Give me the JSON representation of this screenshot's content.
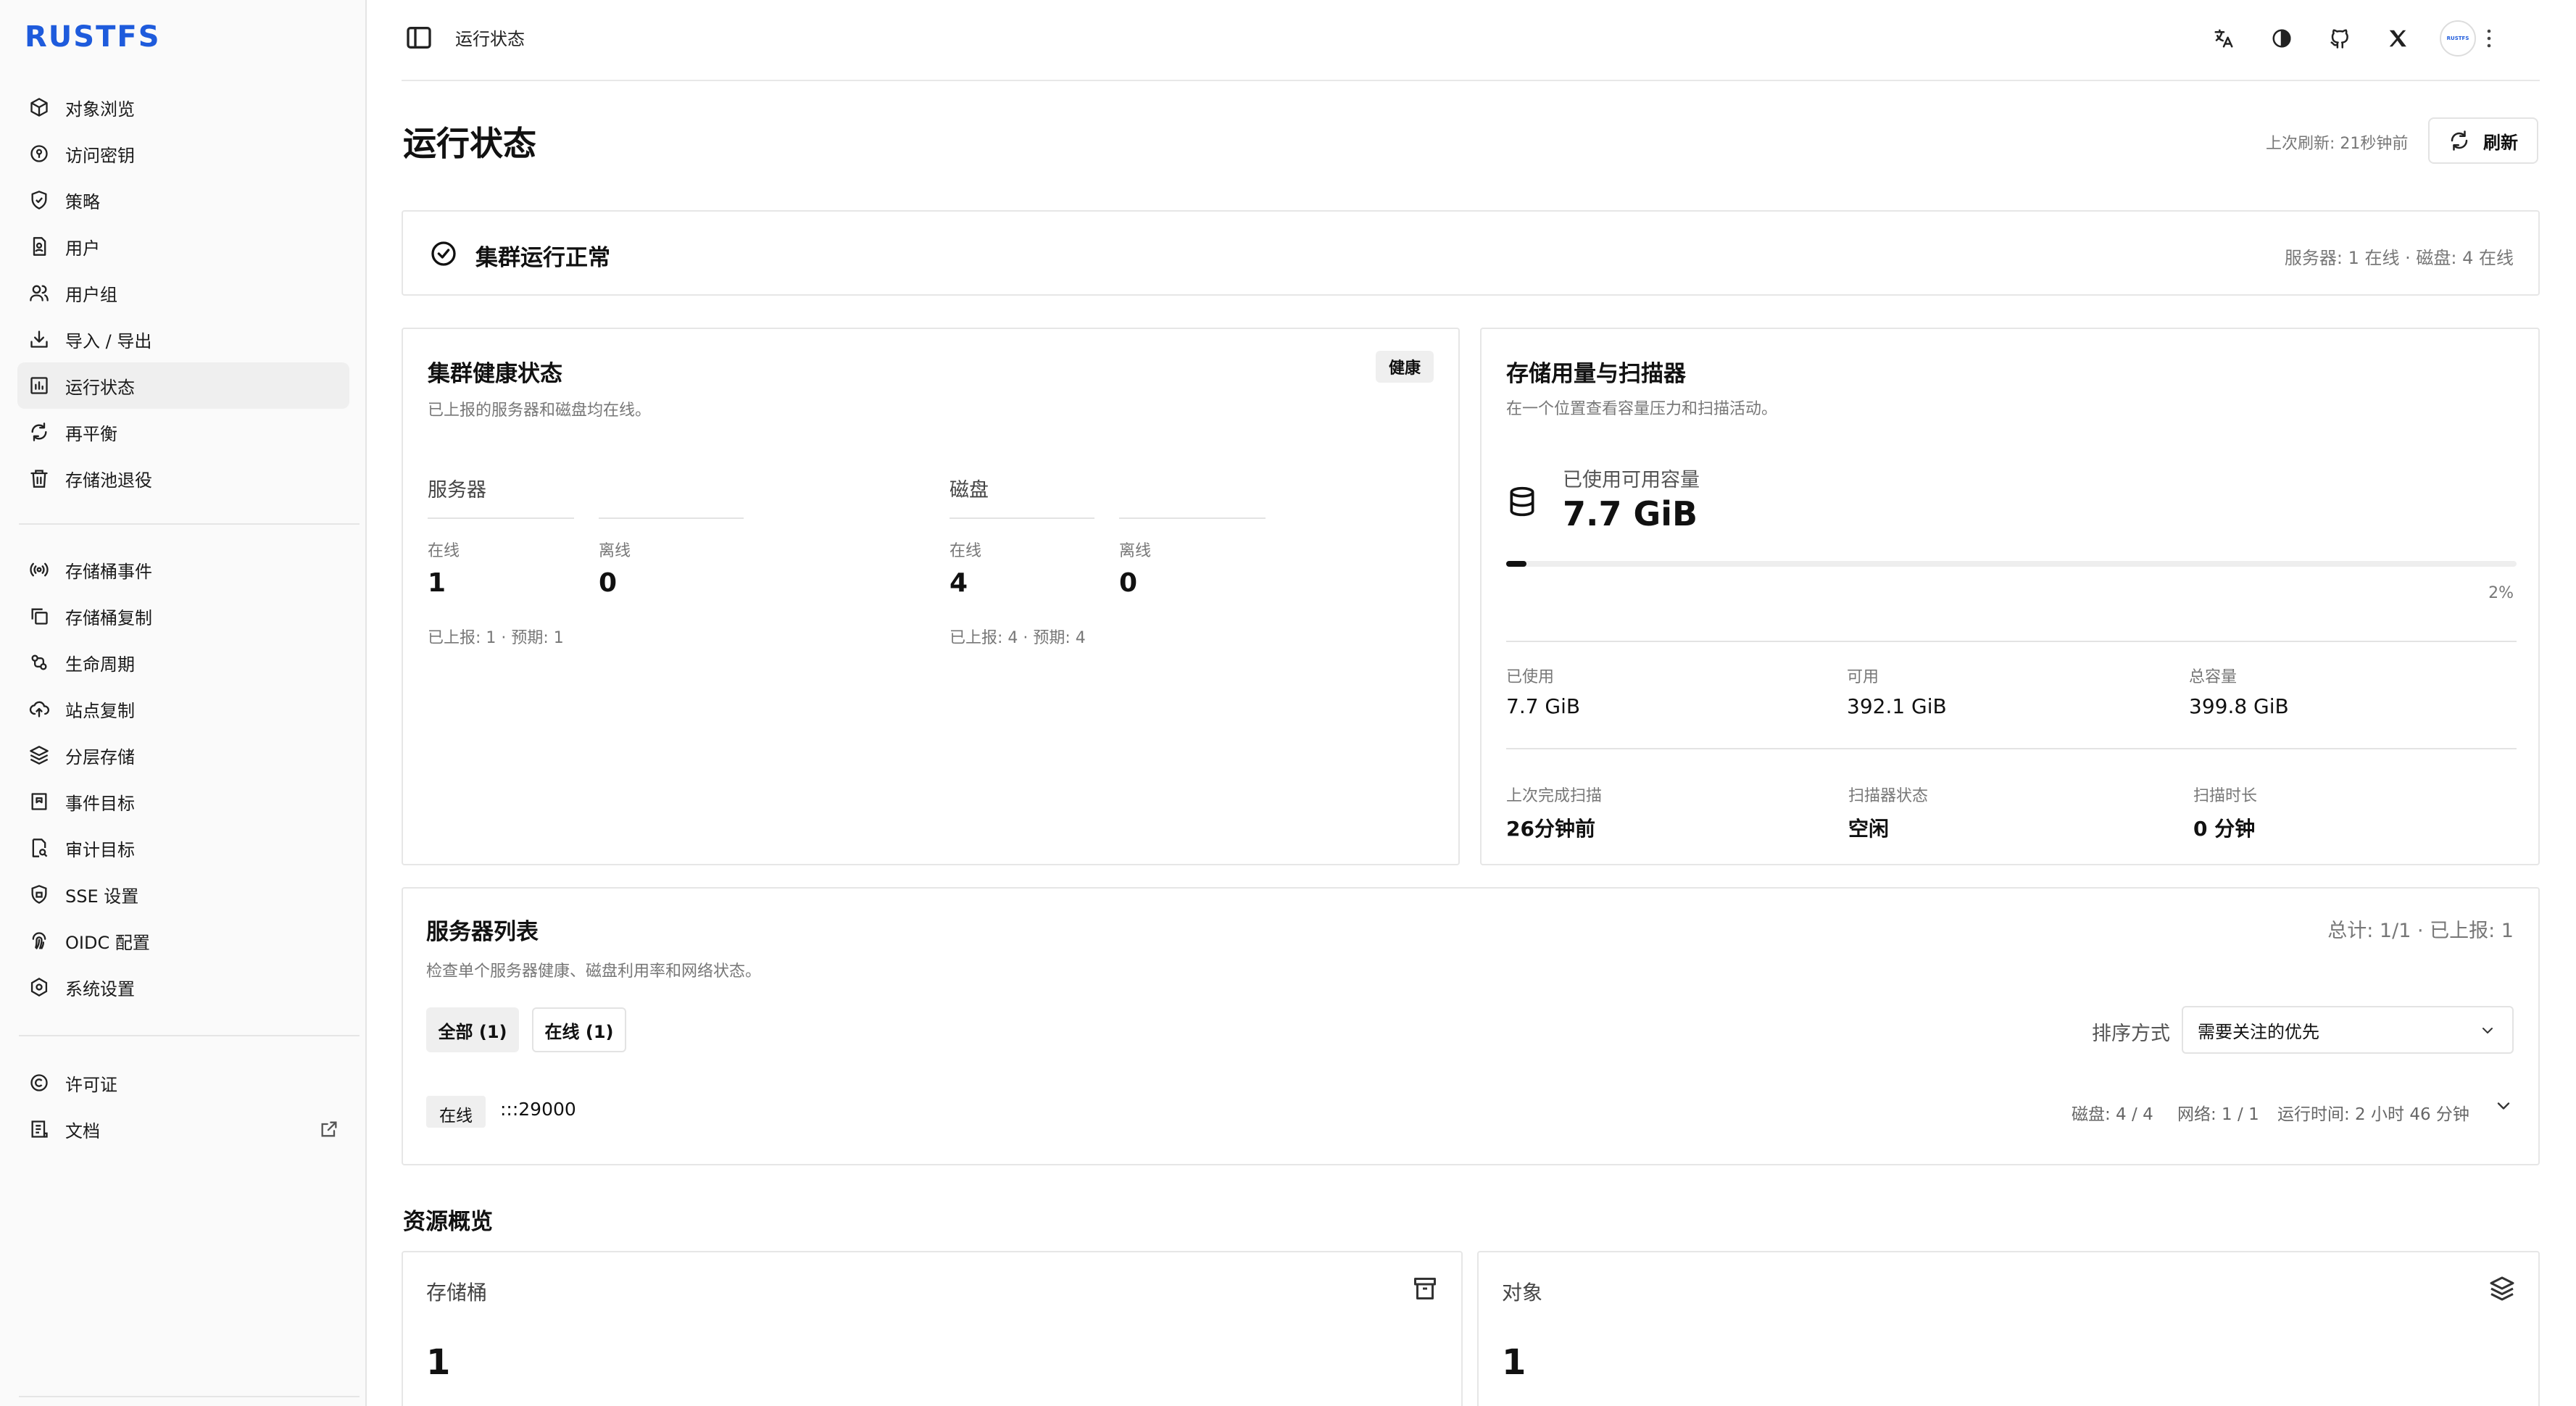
{
  "app": {
    "logo": "RUSTFS",
    "avatar_text": "RUSTFS"
  },
  "sidebar": {
    "group1": [
      {
        "label": "对象浏览",
        "icon": "cube-icon",
        "name": "sidebar-item-object-browser"
      },
      {
        "label": "访问密钥",
        "icon": "key-icon",
        "name": "sidebar-item-access-keys"
      },
      {
        "label": "策略",
        "icon": "shield-icon",
        "name": "sidebar-item-policies"
      },
      {
        "label": "用户",
        "icon": "user-file-icon",
        "name": "sidebar-item-users"
      },
      {
        "label": "用户组",
        "icon": "users-icon",
        "name": "sidebar-item-user-groups"
      },
      {
        "label": "导入 / 导出",
        "icon": "download-icon",
        "name": "sidebar-item-import-export"
      },
      {
        "label": "运行状态",
        "icon": "bar-chart-icon",
        "name": "sidebar-item-status",
        "active": true
      },
      {
        "label": "再平衡",
        "icon": "refresh-icon",
        "name": "sidebar-item-rebalance"
      },
      {
        "label": "存储池退役",
        "icon": "trash-icon",
        "name": "sidebar-item-pool-decommission"
      }
    ],
    "group2": [
      {
        "label": "存储桶事件",
        "icon": "broadcast-icon",
        "name": "sidebar-item-bucket-events"
      },
      {
        "label": "存储桶复制",
        "icon": "copy-icon",
        "name": "sidebar-item-bucket-replication"
      },
      {
        "label": "生命周期",
        "icon": "lifecycle-icon",
        "name": "sidebar-item-lifecycle"
      },
      {
        "label": "站点复制",
        "icon": "cloud-upload-icon",
        "name": "sidebar-item-site-replication"
      },
      {
        "label": "分层存储",
        "icon": "layers-icon",
        "name": "sidebar-item-tiering"
      },
      {
        "label": "事件目标",
        "icon": "target-icon",
        "name": "sidebar-item-event-targets"
      },
      {
        "label": "审计目标",
        "icon": "audit-icon",
        "name": "sidebar-item-audit-targets"
      },
      {
        "label": "SSE 设置",
        "icon": "lock-icon",
        "name": "sidebar-item-sse-settings"
      },
      {
        "label": "OIDC 配置",
        "icon": "fingerprint-icon",
        "name": "sidebar-item-oidc-config"
      },
      {
        "label": "系统设置",
        "icon": "settings-icon",
        "name": "sidebar-item-system-settings"
      }
    ],
    "group3": [
      {
        "label": "许可证",
        "icon": "copyright-icon",
        "name": "sidebar-item-license"
      },
      {
        "label": "文档",
        "icon": "document-icon",
        "name": "sidebar-item-docs",
        "external": true
      }
    ]
  },
  "topbar": {
    "breadcrumb": "运行状态",
    "icons": [
      "translate-icon",
      "theme-icon",
      "github-icon",
      "x-icon"
    ]
  },
  "header": {
    "title": "运行状态",
    "last_refresh": "上次刷新: 21秒钟前",
    "refresh_label": "刷新"
  },
  "banner": {
    "title": "集群运行正常",
    "meta": "服务器: 1 在线 · 磁盘: 4 在线"
  },
  "health": {
    "title": "集群健康状态",
    "subtitle": "已上报的服务器和磁盘均在线。",
    "badge": "健康",
    "servers": {
      "label": "服务器",
      "online_label": "在线",
      "online": "1",
      "offline_label": "离线",
      "offline": "0",
      "note": "已上报: 1 · 预期: 1"
    },
    "disks": {
      "label": "磁盘",
      "online_label": "在线",
      "online": "4",
      "offline_label": "离线",
      "offline": "0",
      "note": "已上报: 4 · 预期: 4"
    }
  },
  "storage": {
    "title": "存储用量与扫描器",
    "subtitle": "在一个位置查看容量压力和扫描活动。",
    "used_capacity_label": "已使用可用容量",
    "used_capacity": "7.7 GiB",
    "usage_percent": 2,
    "usage_percent_text": "2%",
    "used_label": "已使用",
    "used": "7.7 GiB",
    "available_label": "可用",
    "available": "392.1 GiB",
    "total_label": "总容量",
    "total": "399.8 GiB",
    "last_scan_label": "上次完成扫描",
    "last_scan": "26分钟前",
    "scanner_status_label": "扫描器状态",
    "scanner_status": "空闲",
    "scan_duration_label": "扫描时长",
    "scan_duration": "0 分钟"
  },
  "servers": {
    "title": "服务器列表",
    "subtitle": "检查单个服务器健康、磁盘利用率和网络状态。",
    "total": "总计: 1/1 · 已上报: 1",
    "filter_all": "全部 (1)",
    "filter_online": "在线 (1)",
    "sort_label": "排序方式",
    "sort_value": "需要关注的优先",
    "rows": [
      {
        "status": "在线",
        "host": ":::29000",
        "disks": "磁盘: 4 / 4",
        "network": "网络: 1 / 1",
        "uptime": "运行时间: 2 小时 46 分钟"
      }
    ]
  },
  "resources": {
    "title": "资源概览",
    "buckets_label": "存储桶",
    "buckets": "1",
    "objects_label": "对象",
    "objects": "1"
  }
}
